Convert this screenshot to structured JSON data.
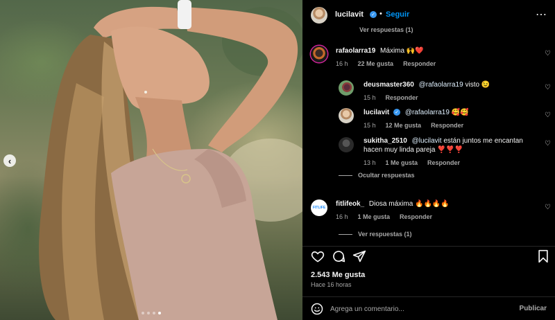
{
  "header": {
    "username": "lucilavit",
    "follow_separator": "•",
    "follow_label": "Seguir",
    "more_icon": "more-dots-icon"
  },
  "top_thread": {
    "view_replies": "Ver respuestas (1)"
  },
  "comments": [
    {
      "username": "rafaolarra19",
      "text": "Máxima 🙌❤️",
      "time": "16 h",
      "likes": "22 Me gusta",
      "reply": "Responder"
    },
    {
      "username": "deusmaster360",
      "mention": "@rafaolarra19",
      "text": " visto 😉",
      "time": "15 h",
      "reply": "Responder"
    },
    {
      "username": "lucilavit",
      "mention": "@rafaolarra19",
      "text": " 🥰🥰",
      "time": "15 h",
      "likes": "12 Me gusta",
      "reply": "Responder"
    },
    {
      "username": "sukitha_2510",
      "mention": "@lucilavit",
      "text": " están juntos me encantan",
      "text2": "hacen muy linda pareja ❣️❣️❣️",
      "time": "13 h",
      "likes": "1 Me gusta",
      "reply": "Responder"
    },
    {
      "username": "fitlifeok_",
      "text": "Diosa máxima 🔥🔥🔥🔥",
      "time": "16 h",
      "likes": "1 Me gusta",
      "reply": "Responder",
      "avatar_text": "FITLIFE"
    }
  ],
  "hide_replies": "Ocultar respuestas",
  "bottom_view_replies": "Ver respuestas (1)",
  "post": {
    "likes": "2.543 Me gusta",
    "time_ago": "Hace 16 horas"
  },
  "add_comment": {
    "placeholder": "Agrega un comentario...",
    "publish": "Publicar"
  },
  "carousel": {
    "count": 4,
    "active_index": 3
  },
  "colors": {
    "accent": "#0095f6",
    "background": "#000000",
    "muted": "#a8a8a8",
    "verified": "#3897f0"
  }
}
